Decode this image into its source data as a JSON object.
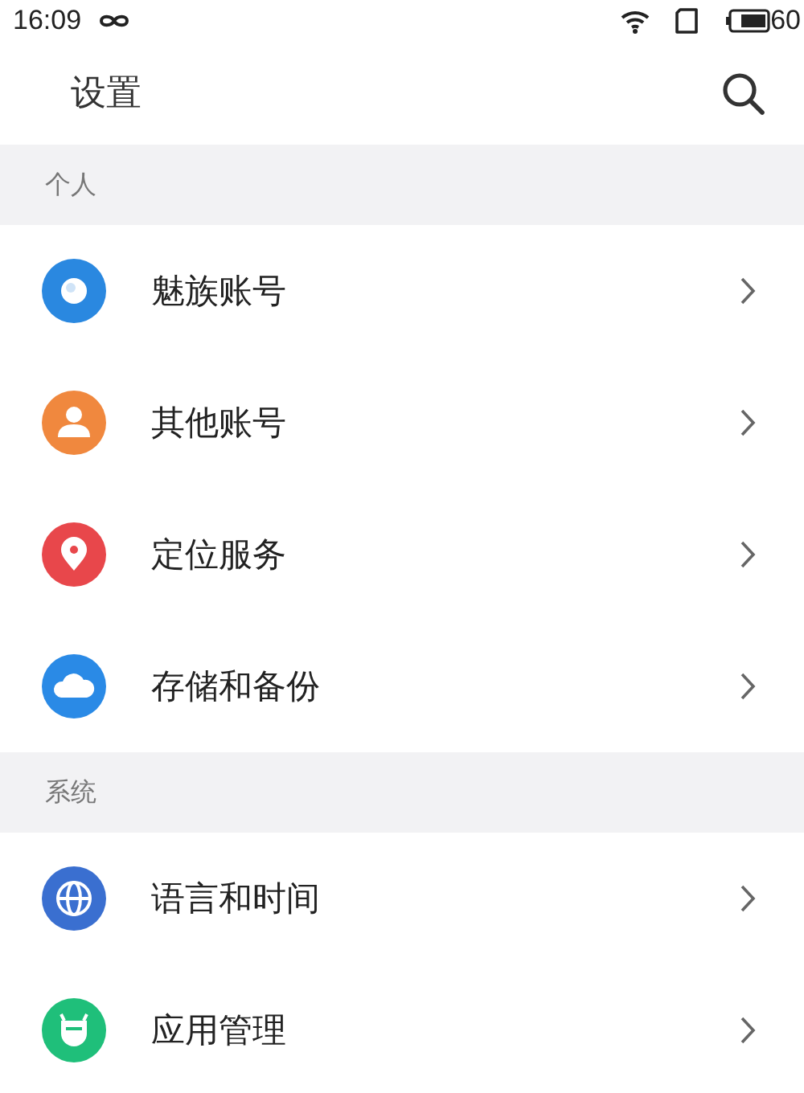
{
  "status_bar": {
    "time": "16:09",
    "battery": "60"
  },
  "header": {
    "title": "设置"
  },
  "sections": [
    {
      "title": "个人",
      "items": [
        {
          "label": "魅族账号",
          "kind": "account",
          "color": "#2a88e0"
        },
        {
          "label": "其他账号",
          "kind": "person",
          "color": "#f0883e"
        },
        {
          "label": "定位服务",
          "kind": "location",
          "color": "#e8474b"
        },
        {
          "label": "存储和备份",
          "kind": "cloud",
          "color": "#2a8ae6"
        }
      ]
    },
    {
      "title": "系统",
      "items": [
        {
          "label": "语言和时间",
          "kind": "globe",
          "color": "#3a6fd0"
        },
        {
          "label": "应用管理",
          "kind": "app",
          "color": "#1fbf7a"
        }
      ]
    }
  ]
}
